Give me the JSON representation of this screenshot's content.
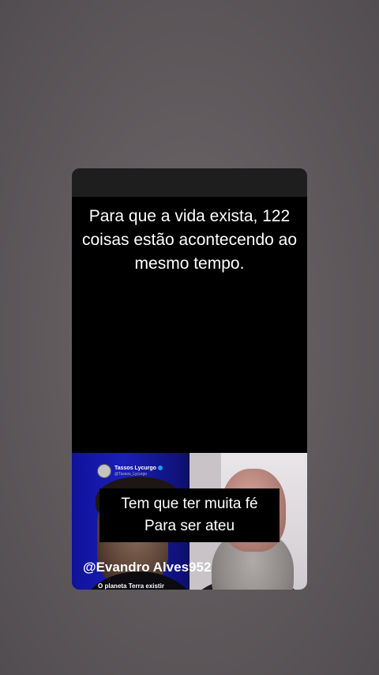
{
  "story": {
    "top_caption": "Para que a vida exista, 122 coisas estão acontecendo ao mesmo tempo.",
    "bottom_caption_line1": "Tem que ter muita fé",
    "bottom_caption_line2": "Para ser ateu",
    "username": "@Evandro Alves952"
  },
  "left_video": {
    "tweet_name": "Tassos Lycurgo",
    "tweet_handle": "@Tassos_Lycurgo",
    "subtitle": "O planeta Terra existir por acaso,"
  }
}
